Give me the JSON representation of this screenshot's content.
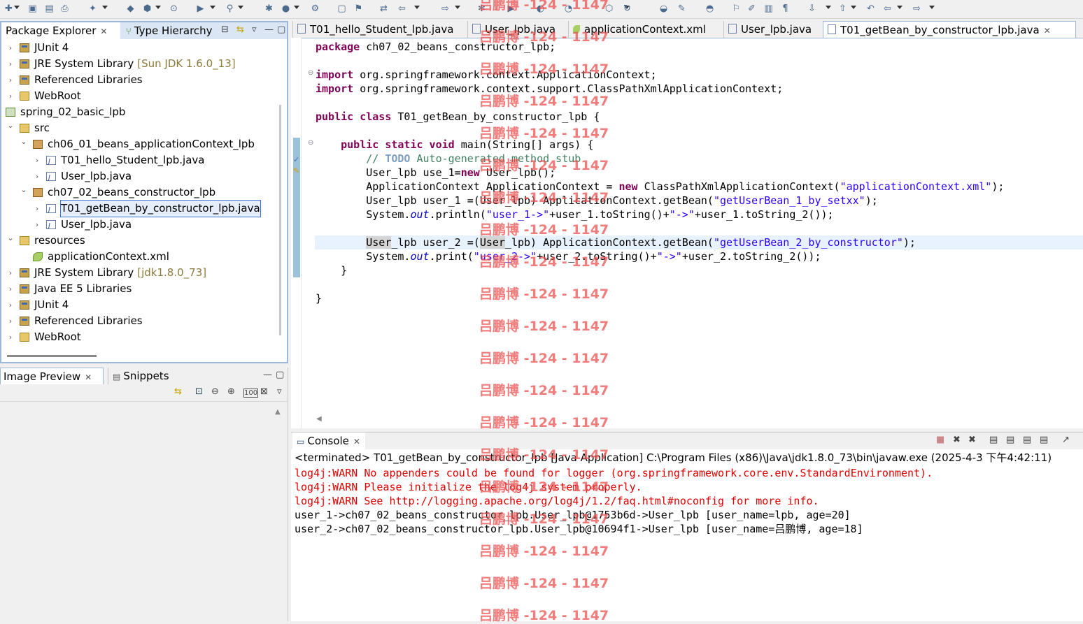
{
  "toolbar_icons": [
    "new-icon",
    "save-icon",
    "save-all-icon",
    "print-icon",
    "new-wizard-icon",
    "package-icon",
    "deploy-icon",
    "server-icon",
    "run-config-icon",
    "search-icon",
    "debug-icon",
    "run-icon",
    "external-tools-icon",
    "open-type-icon",
    "open-task-icon",
    "toggle-icon",
    "back-icon",
    "forward-icon"
  ],
  "package_explorer": {
    "tab_label": "Package Explorer",
    "tab2_label": "Type Hierarchy",
    "items": [
      {
        "label": "JUnit 4",
        "decor": "",
        "level": 0,
        "chevron": ">",
        "icon": "jar"
      },
      {
        "label": "JRE System Library",
        "decor": "[Sun JDK 1.6.0_13]",
        "level": 0,
        "chevron": ">",
        "icon": "jar"
      },
      {
        "label": "Referenced Libraries",
        "decor": "",
        "level": 0,
        "chevron": ">",
        "icon": "jar"
      },
      {
        "label": "WebRoot",
        "decor": "",
        "level": 0,
        "chevron": ">",
        "icon": "folder"
      },
      {
        "label": "spring_02_basic_lpb",
        "decor": "",
        "level": -1,
        "chevron": "",
        "icon": "proj"
      },
      {
        "label": "src",
        "decor": "",
        "level": 0,
        "chevron": "v",
        "icon": "src"
      },
      {
        "label": "ch06_01_beans_applicationContext_lpb",
        "decor": "",
        "level": 1,
        "chevron": "v",
        "icon": "pkg"
      },
      {
        "label": "T01_hello_Student_lpb.java",
        "decor": "",
        "level": 2,
        "chevron": ">",
        "icon": "java"
      },
      {
        "label": "User_lpb.java",
        "decor": "",
        "level": 2,
        "chevron": ">",
        "icon": "java"
      },
      {
        "label": "ch07_02_beans_constructor_lpb",
        "decor": "",
        "level": 1,
        "chevron": "v",
        "icon": "pkg"
      },
      {
        "label": "T01_getBean_by_constructor_lpb.java",
        "decor": "",
        "level": 2,
        "chevron": ">",
        "icon": "java",
        "selected": true
      },
      {
        "label": "User_lpb.java",
        "decor": "",
        "level": 2,
        "chevron": ">",
        "icon": "java"
      },
      {
        "label": "resources",
        "decor": "",
        "level": 0,
        "chevron": "v",
        "icon": "src"
      },
      {
        "label": "applicationContext.xml",
        "decor": "",
        "level": 1,
        "chevron": "",
        "icon": "xml"
      },
      {
        "label": "JRE System Library",
        "decor": "[jdk1.8.0_73]",
        "level": 0,
        "chevron": ">",
        "icon": "jar"
      },
      {
        "label": "Java EE 5 Libraries",
        "decor": "",
        "level": 0,
        "chevron": ">",
        "icon": "jar"
      },
      {
        "label": "JUnit 4",
        "decor": "",
        "level": 0,
        "chevron": ">",
        "icon": "jar"
      },
      {
        "label": "Referenced Libraries",
        "decor": "",
        "level": 0,
        "chevron": ">",
        "icon": "jar"
      },
      {
        "label": "WebRoot",
        "decor": "",
        "level": 0,
        "chevron": ">",
        "icon": "folder"
      }
    ]
  },
  "image_preview": {
    "tab_label": "Image Preview",
    "tab2_label": "Snippets"
  },
  "editor": {
    "tabs": [
      {
        "label": "T01_hello_Student_lpb.java",
        "active": false
      },
      {
        "label": "User_lpb.java",
        "active": false
      },
      {
        "label": "applicationContext.xml",
        "active": false
      },
      {
        "label": "User_lpb.java",
        "active": false
      },
      {
        "label": "T01_getBean_by_constructor_lpb.java",
        "active": true
      }
    ]
  },
  "console": {
    "tab_label": "Console",
    "header": "<terminated> T01_getBean_by_constructor_lpb [Java Application] C:\\Program Files (x86)\\Java\\jdk1.8.0_73\\bin\\javaw.exe (2025-4-3 下午4:42:11)",
    "lines": [
      {
        "text": "log4j:WARN No appenders could be found for logger (org.springframework.core.env.StandardEnvironment).",
        "warn": true
      },
      {
        "text": "log4j:WARN Please initialize the log4j system properly.",
        "warn": true
      },
      {
        "text": "log4j:WARN See http://logging.apache.org/log4j/1.2/faq.html#noconfig for more info.",
        "warn": true
      },
      {
        "text": "user_1->ch07_02_beans_constructor_lpb.User_lpb@1753b6d->User_lpb [user_name=lpb, age=20]",
        "warn": false
      },
      {
        "text": "user_2->ch07_02_beans_constructor_lpb.User_lpb@10694f1->User_lpb [user_name=吕鹏博, age=18]",
        "warn": false
      }
    ]
  },
  "watermark": "吕鹏博 -124 - 1147"
}
